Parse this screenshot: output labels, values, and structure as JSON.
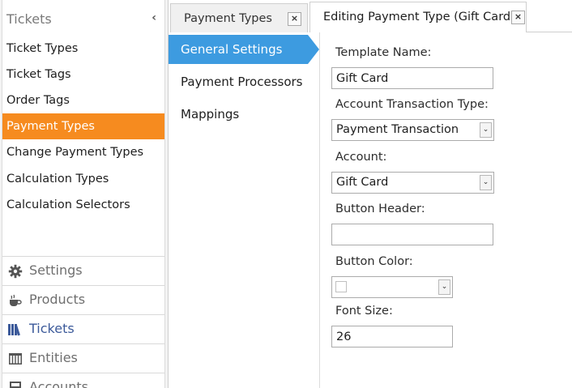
{
  "sidebar": {
    "title": "Tickets",
    "collapse_glyph": "‹",
    "items": [
      {
        "label": "Ticket Types",
        "active": false
      },
      {
        "label": "Ticket Tags",
        "active": false
      },
      {
        "label": "Order Tags",
        "active": false
      },
      {
        "label": "Payment Types",
        "active": true
      },
      {
        "label": "Change Payment Types",
        "active": false
      },
      {
        "label": "Calculation Types",
        "active": false
      },
      {
        "label": "Calculation Selectors",
        "active": false
      }
    ],
    "sections": [
      {
        "label": "Settings",
        "icon": "gear-icon"
      },
      {
        "label": "Products",
        "icon": "coffee-cup-icon"
      },
      {
        "label": "Tickets",
        "icon": "books-icon",
        "current": true
      },
      {
        "label": "Entities",
        "icon": "table-icon"
      },
      {
        "label": "Accounts",
        "icon": "calculator-icon"
      }
    ]
  },
  "tabs": [
    {
      "label": "Payment Types",
      "active": false,
      "close": "×"
    },
    {
      "label": "Editing Payment Type (Gift Card)",
      "active": true,
      "close": "×"
    }
  ],
  "settings_list": [
    {
      "label": "General Settings",
      "active": true
    },
    {
      "label": "Payment Processors",
      "active": false
    },
    {
      "label": "Mappings",
      "active": false
    }
  ],
  "form": {
    "template_name_label": "Template Name:",
    "template_name_value": "Gift Card",
    "account_transaction_type_label": "Account Transaction Type:",
    "account_transaction_type_value": "Payment Transaction",
    "account_label": "Account:",
    "account_value": "Gift Card",
    "button_header_label": "Button Header:",
    "button_header_value": "",
    "button_color_label": "Button Color:",
    "button_color_value": "#ffffff",
    "font_size_label": "Font Size:",
    "font_size_value": "26",
    "dropdown_glyph": "⌄"
  },
  "colors": {
    "active_sidebar": "#f68b1f",
    "active_setting": "#3d9be0",
    "current_section": "#3c5a9a"
  }
}
